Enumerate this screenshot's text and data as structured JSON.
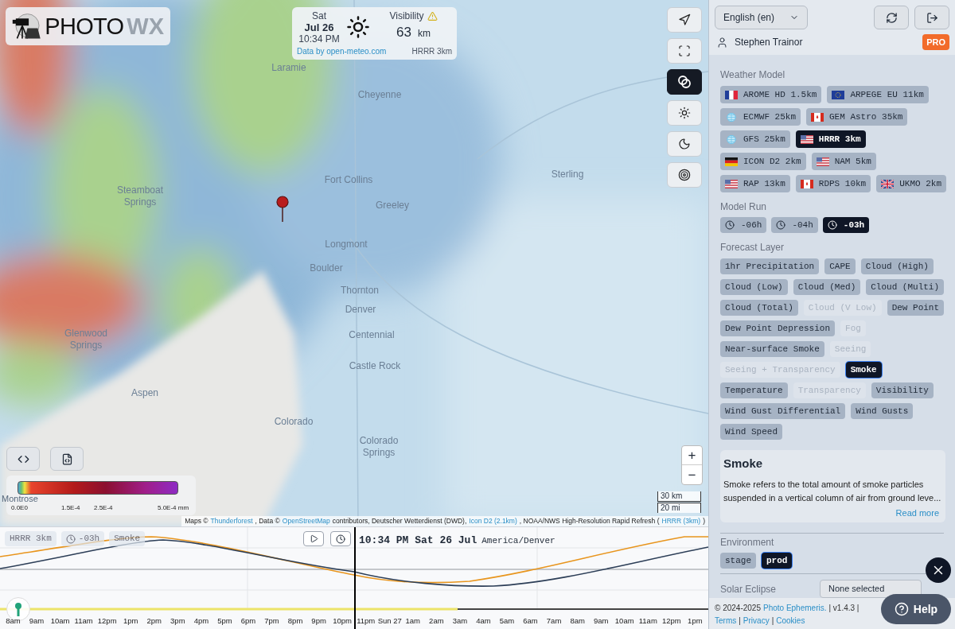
{
  "logo": {
    "main": "PHOTO",
    "accent": "WX"
  },
  "conditions": {
    "day": "Sat",
    "date": "Jul 26",
    "time": "10:34 PM",
    "metric": "Visibility",
    "warning": true,
    "value": "63",
    "unit": "km",
    "source": "Data by open-meteo.com",
    "model": "HRRR 3km"
  },
  "map_controls": [
    {
      "kind": "locate",
      "selected": false
    },
    {
      "kind": "fullscreen",
      "selected": false
    },
    {
      "kind": "layers",
      "selected": true
    },
    {
      "kind": "sun",
      "selected": false
    },
    {
      "kind": "moon",
      "selected": false
    },
    {
      "kind": "target",
      "selected": false
    }
  ],
  "map_labels": [
    "Laramie",
    "Cheyenne",
    "Fort Collins",
    "Greeley",
    "Sterling",
    "Steamboat Springs",
    "Longmont",
    "Boulder",
    "Thornton",
    "Denver",
    "Centennial",
    "Castle Rock",
    "Glenwood Springs",
    "Aspen",
    "Colorado",
    "Colorado Springs",
    "Montrose"
  ],
  "legend": {
    "ticks": [
      "0.0E0",
      "1.5E-4",
      "2.5E-4",
      "5.0E-4 mm"
    ]
  },
  "zoom": [
    "+",
    "−"
  ],
  "scale": [
    "30 km",
    "20 mi"
  ],
  "attribution": [
    {
      "text": "Maps ©",
      "kind": "text"
    },
    {
      "text": "Thunderforest",
      "kind": "link"
    },
    {
      "text": ", Data ©",
      "kind": "text"
    },
    {
      "text": "OpenStreetMap",
      "kind": "link"
    },
    {
      "text": "contributors, Deutscher Wetterdienst (DWD),",
      "kind": "text"
    },
    {
      "text": "Icon D2 (2.1km)",
      "kind": "link"
    },
    {
      "text": ", NOAA/NWS High-Resolution Rapid Refresh (",
      "kind": "text"
    },
    {
      "text": "HRRR (3km)",
      "kind": "link"
    },
    {
      "text": ")",
      "kind": "text"
    }
  ],
  "timeline": {
    "chips": [
      {
        "kind": "model",
        "text": "HRRR 3km"
      },
      {
        "kind": "run",
        "text": "-03h"
      },
      {
        "kind": "layer",
        "text": "Smoke"
      }
    ],
    "time": "10:34 PM Sat 26 Jul",
    "timezone": "America/Denver",
    "hours": [
      "8am",
      "9am",
      "10am",
      "11am",
      "12pm",
      "1pm",
      "2pm",
      "3pm",
      "4pm",
      "5pm",
      "6pm",
      "7pm",
      "8pm",
      "9pm",
      "10pm",
      "11pm",
      "Sun 27",
      "1am",
      "2am",
      "3am",
      "4am",
      "5am",
      "6am",
      "7am",
      "8am",
      "9am",
      "10am",
      "11am",
      "12pm",
      "1pm"
    ]
  },
  "sidebar": {
    "language": "English (en)",
    "user": "Stephen Trainor",
    "badge": "PRO",
    "weather_model": {
      "title": "Weather Model",
      "options": [
        {
          "label": "AROME HD 1.5km",
          "kind": "fr",
          "selected": false
        },
        {
          "label": "ARPEGE EU 11km",
          "kind": "eu",
          "selected": false
        },
        {
          "label": "ECMWF 25km",
          "kind": "globe",
          "selected": false
        },
        {
          "label": "GEM Astro 35km",
          "kind": "ca",
          "selected": false
        },
        {
          "label": "GFS 25km",
          "kind": "globe",
          "selected": false
        },
        {
          "label": "HRRR 3km",
          "kind": "us",
          "selected": true
        },
        {
          "label": "ICON D2 2km",
          "kind": "de",
          "selected": false
        },
        {
          "label": "NAM 5km",
          "kind": "us",
          "selected": false
        },
        {
          "label": "RAP 13km",
          "kind": "us",
          "selected": false
        },
        {
          "label": "RDPS 10km",
          "kind": "ca",
          "selected": false
        },
        {
          "label": "UKMO 2km",
          "kind": "gb",
          "selected": false
        }
      ]
    },
    "model_run": {
      "title": "Model Run",
      "options": [
        {
          "label": "-06h",
          "selected": false
        },
        {
          "label": "-04h",
          "selected": false
        },
        {
          "label": "-03h",
          "selected": true
        }
      ]
    },
    "forecast_layer": {
      "title": "Forecast Layer",
      "options": [
        {
          "label": "1hr Precipitation",
          "selected": false,
          "disabled": false
        },
        {
          "label": "CAPE",
          "selected": false,
          "disabled": false
        },
        {
          "label": "Cloud (High)",
          "selected": false,
          "disabled": false
        },
        {
          "label": "Cloud (Low)",
          "selected": false,
          "disabled": false
        },
        {
          "label": "Cloud (Med)",
          "selected": false,
          "disabled": false
        },
        {
          "label": "Cloud (Multi)",
          "selected": false,
          "disabled": false
        },
        {
          "label": "Cloud (Total)",
          "selected": false,
          "disabled": false
        },
        {
          "label": "Cloud (V Low)",
          "selected": false,
          "disabled": true
        },
        {
          "label": "Dew Point",
          "selected": false,
          "disabled": false
        },
        {
          "label": "Dew Point Depression",
          "selected": false,
          "disabled": false
        },
        {
          "label": "Fog",
          "selected": false,
          "disabled": true
        },
        {
          "label": "Near-surface Smoke",
          "selected": false,
          "disabled": false
        },
        {
          "label": "Seeing",
          "selected": false,
          "disabled": true
        },
        {
          "label": "Seeing + Transparency",
          "selected": false,
          "disabled": true
        },
        {
          "label": "Smoke",
          "selected": true,
          "disabled": false
        },
        {
          "label": "Temperature",
          "selected": false,
          "disabled": false
        },
        {
          "label": "Transparency",
          "selected": false,
          "disabled": true
        },
        {
          "label": "Visibility",
          "selected": false,
          "disabled": false
        },
        {
          "label": "Wind Gust Differential",
          "selected": false,
          "disabled": false
        },
        {
          "label": "Wind Gusts",
          "selected": false,
          "disabled": false
        },
        {
          "label": "Wind Speed",
          "selected": false,
          "disabled": false
        }
      ]
    },
    "info": {
      "title": "Smoke",
      "text": "Smoke refers to the total amount of smoke particles suspended in a vertical column of air from ground leve...",
      "link": "Read more"
    },
    "environment": {
      "title": "Environment",
      "options": [
        {
          "label": "stage",
          "selected": false
        },
        {
          "label": "prod",
          "selected": true
        }
      ]
    },
    "solar_eclipse": {
      "label": "Solar Eclipse",
      "value": "None selected"
    },
    "footer": [
      {
        "text": "© 2024-2025",
        "kind": "text"
      },
      {
        "text": "Photo Ephemeris.",
        "kind": "link"
      },
      {
        "text": "| v1.4.3 |",
        "kind": "text"
      },
      {
        "text": "Terms",
        "kind": "link"
      },
      {
        "text": "|",
        "kind": "text"
      },
      {
        "text": "Privacy",
        "kind": "link"
      },
      {
        "text": "|",
        "kind": "text"
      },
      {
        "text": "Cookies",
        "kind": "link"
      }
    ]
  },
  "help_button": "Help"
}
